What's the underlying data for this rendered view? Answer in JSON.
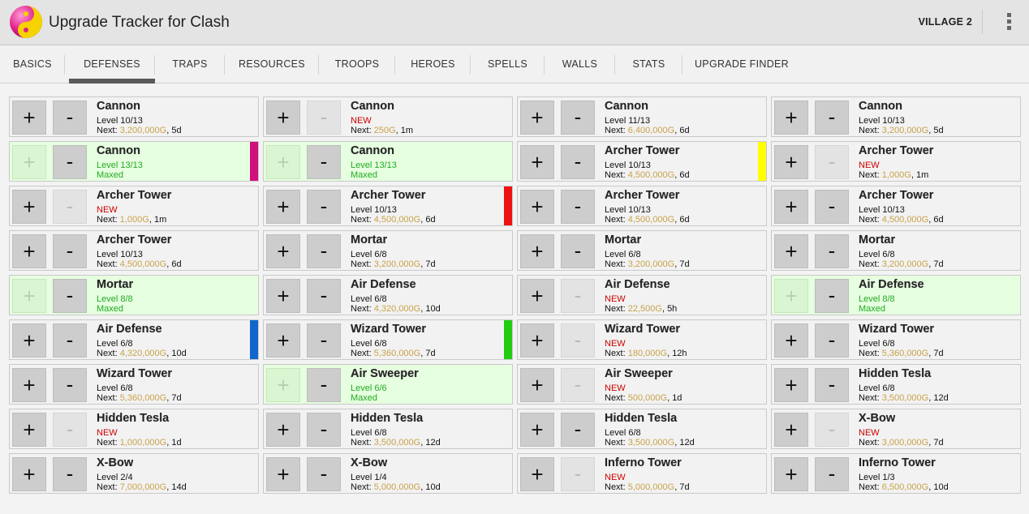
{
  "app": {
    "title": "Upgrade Tracker for Clash",
    "village": "VILLAGE 2"
  },
  "tabs": [
    "BASICS",
    "DEFENSES",
    "TRAPS",
    "RESOURCES",
    "TROOPS",
    "HEROES",
    "SPELLS",
    "WALLS",
    "STATS",
    "UPGRADE FINDER"
  ],
  "active_tab": "DEFENSES",
  "buttons": {
    "plus": "+",
    "minus": "-"
  },
  "next_prefix": "Next: ",
  "colors": {
    "magenta": "#d0107c",
    "yellow": "#ffff00",
    "red": "#ee1111",
    "blue": "#1166cc",
    "green": "#22cc11"
  },
  "columns": [
    [
      {
        "name": "Cannon",
        "level": "Level 10/13",
        "status": "normal",
        "cost": "3,200,000G",
        "time": "5d",
        "minus_enabled": true,
        "plus_enabled": true
      },
      {
        "name": "Cannon",
        "level": "Level 13/13",
        "status": "maxed",
        "maxed_text": "Maxed",
        "minus_enabled": true,
        "plus_enabled": false,
        "flag": "magenta"
      },
      {
        "name": "Archer Tower",
        "level": "NEW",
        "status": "new",
        "cost": "1,000G",
        "time": "1m",
        "minus_enabled": false,
        "plus_enabled": true
      },
      {
        "name": "Archer Tower",
        "level": "Level 10/13",
        "status": "normal",
        "cost": "4,500,000G",
        "time": "6d",
        "minus_enabled": true,
        "plus_enabled": true
      },
      {
        "name": "Mortar",
        "level": "Level 8/8",
        "status": "maxed",
        "maxed_text": "Maxed",
        "minus_enabled": true,
        "plus_enabled": false
      },
      {
        "name": "Air Defense",
        "level": "Level 6/8",
        "status": "normal",
        "cost": "4,320,000G",
        "time": "10d",
        "minus_enabled": true,
        "plus_enabled": true,
        "flag": "blue"
      },
      {
        "name": "Wizard Tower",
        "level": "Level 6/8",
        "status": "normal",
        "cost": "5,360,000G",
        "time": "7d",
        "minus_enabled": true,
        "plus_enabled": true
      },
      {
        "name": "Hidden Tesla",
        "level": "NEW",
        "status": "new",
        "cost": "1,000,000G",
        "time": "1d",
        "minus_enabled": false,
        "plus_enabled": true
      },
      {
        "name": "X-Bow",
        "level": "Level 2/4",
        "status": "normal",
        "cost": "7,000,000G",
        "time": "14d",
        "minus_enabled": true,
        "plus_enabled": true
      }
    ],
    [
      {
        "name": "Cannon",
        "level": "NEW",
        "status": "new",
        "cost": "250G",
        "time": "1m",
        "minus_enabled": false,
        "plus_enabled": true
      },
      {
        "name": "Cannon",
        "level": "Level 13/13",
        "status": "maxed",
        "maxed_text": "Maxed",
        "minus_enabled": true,
        "plus_enabled": false
      },
      {
        "name": "Archer Tower",
        "level": "Level 10/13",
        "status": "normal",
        "cost": "4,500,000G",
        "time": "6d",
        "minus_enabled": true,
        "plus_enabled": true,
        "flag": "red"
      },
      {
        "name": "Mortar",
        "level": "Level 6/8",
        "status": "normal",
        "cost": "3,200,000G",
        "time": "7d",
        "minus_enabled": true,
        "plus_enabled": true
      },
      {
        "name": "Air Defense",
        "level": "Level 6/8",
        "status": "normal",
        "cost": "4,320,000G",
        "time": "10d",
        "minus_enabled": true,
        "plus_enabled": true
      },
      {
        "name": "Wizard Tower",
        "level": "Level 6/8",
        "status": "normal",
        "cost": "5,360,000G",
        "time": "7d",
        "minus_enabled": true,
        "plus_enabled": true,
        "flag": "green"
      },
      {
        "name": "Air Sweeper",
        "level": "Level 6/6",
        "status": "maxed",
        "maxed_text": "Maxed",
        "minus_enabled": true,
        "plus_enabled": false
      },
      {
        "name": "Hidden Tesla",
        "level": "Level 6/8",
        "status": "normal",
        "cost": "3,500,000G",
        "time": "12d",
        "minus_enabled": true,
        "plus_enabled": true
      },
      {
        "name": "X-Bow",
        "level": "Level 1/4",
        "status": "normal",
        "cost": "5,000,000G",
        "time": "10d",
        "minus_enabled": true,
        "plus_enabled": true
      }
    ],
    [
      {
        "name": "Cannon",
        "level": "Level 11/13",
        "status": "normal",
        "cost": "6,400,000G",
        "time": "6d",
        "minus_enabled": true,
        "plus_enabled": true
      },
      {
        "name": "Archer Tower",
        "level": "Level 10/13",
        "status": "normal",
        "cost": "4,500,000G",
        "time": "6d",
        "minus_enabled": true,
        "plus_enabled": true,
        "flag": "yellow"
      },
      {
        "name": "Archer Tower",
        "level": "Level 10/13",
        "status": "normal",
        "cost": "4,500,000G",
        "time": "6d",
        "minus_enabled": true,
        "plus_enabled": true
      },
      {
        "name": "Mortar",
        "level": "Level 6/8",
        "status": "normal",
        "cost": "3,200,000G",
        "time": "7d",
        "minus_enabled": true,
        "plus_enabled": true
      },
      {
        "name": "Air Defense",
        "level": "NEW",
        "status": "new",
        "cost": "22,500G",
        "time": "5h",
        "minus_enabled": false,
        "plus_enabled": true
      },
      {
        "name": "Wizard Tower",
        "level": "NEW",
        "status": "new",
        "cost": "180,000G",
        "time": "12h",
        "minus_enabled": false,
        "plus_enabled": true
      },
      {
        "name": "Air Sweeper",
        "level": "NEW",
        "status": "new",
        "cost": "500,000G",
        "time": "1d",
        "minus_enabled": false,
        "plus_enabled": true
      },
      {
        "name": "Hidden Tesla",
        "level": "Level 6/8",
        "status": "normal",
        "cost": "3,500,000G",
        "time": "12d",
        "minus_enabled": true,
        "plus_enabled": true
      },
      {
        "name": "Inferno Tower",
        "level": "NEW",
        "status": "new",
        "cost": "5,000,000G",
        "time": "7d",
        "minus_enabled": false,
        "plus_enabled": true
      }
    ],
    [
      {
        "name": "Cannon",
        "level": "Level 10/13",
        "status": "normal",
        "cost": "3,200,000G",
        "time": "5d",
        "minus_enabled": true,
        "plus_enabled": true
      },
      {
        "name": "Archer Tower",
        "level": "NEW",
        "status": "new",
        "cost": "1,000G",
        "time": "1m",
        "minus_enabled": false,
        "plus_enabled": true
      },
      {
        "name": "Archer Tower",
        "level": "Level 10/13",
        "status": "normal",
        "cost": "4,500,000G",
        "time": "6d",
        "minus_enabled": true,
        "plus_enabled": true
      },
      {
        "name": "Mortar",
        "level": "Level 6/8",
        "status": "normal",
        "cost": "3,200,000G",
        "time": "7d",
        "minus_enabled": true,
        "plus_enabled": true
      },
      {
        "name": "Air Defense",
        "level": "Level 8/8",
        "status": "maxed",
        "maxed_text": "Maxed",
        "minus_enabled": true,
        "plus_enabled": false
      },
      {
        "name": "Wizard Tower",
        "level": "Level 6/8",
        "status": "normal",
        "cost": "5,360,000G",
        "time": "7d",
        "minus_enabled": true,
        "plus_enabled": true
      },
      {
        "name": "Hidden Tesla",
        "level": "Level 6/8",
        "status": "normal",
        "cost": "3,500,000G",
        "time": "12d",
        "minus_enabled": true,
        "plus_enabled": true
      },
      {
        "name": "X-Bow",
        "level": "NEW",
        "status": "new",
        "cost": "3,000,000G",
        "time": "7d",
        "minus_enabled": false,
        "plus_enabled": true
      },
      {
        "name": "Inferno Tower",
        "level": "Level 1/3",
        "status": "normal",
        "cost": "6,500,000G",
        "time": "10d",
        "minus_enabled": true,
        "plus_enabled": true
      }
    ]
  ]
}
